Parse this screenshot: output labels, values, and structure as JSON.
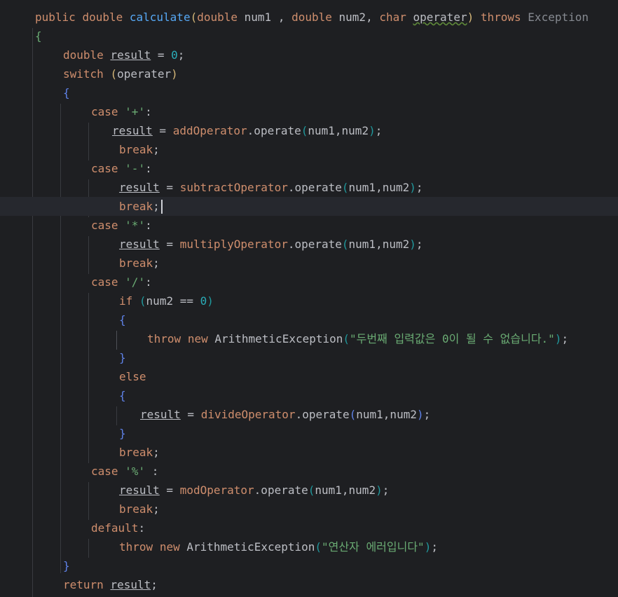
{
  "editor": {
    "signature": {
      "public": "public",
      "double": "double",
      "name": "calculate",
      "paren_open": "(",
      "t1": "double",
      "p1": "num1 ,",
      "t2": "double",
      "p2": "num2,",
      "t3": "char",
      "p3": "operater",
      "paren_close": ")",
      "throws": "throws",
      "exception": "Exception"
    },
    "brace_open_1": "{",
    "decl": {
      "type": "double",
      "var": "result",
      "eq": " = ",
      "val": "0",
      "semi": ";"
    },
    "switch": {
      "kw": "switch",
      "open": "(",
      "arg": "operater",
      "close": ")"
    },
    "brace_open_2": "{",
    "case_plus": {
      "kw": "case",
      "lit": "'+'",
      "colon": ":"
    },
    "stmt_add": {
      "var": "result",
      "eq": " = ",
      "obj": "addOperator",
      "call": ".operate",
      "open": "(",
      "args": "num1,num2",
      "close": ")",
      "semi": ";"
    },
    "break_1": {
      "kw": "break",
      "semi": ";"
    },
    "case_minus": {
      "kw": "case",
      "lit": "'-'",
      "colon": ":"
    },
    "stmt_sub": {
      "var": "result",
      "eq": " = ",
      "obj": "subtractOperator",
      "call": ".operate",
      "open": "(",
      "args": "num1,num2",
      "close": ")",
      "semi": ";"
    },
    "break_2": {
      "kw": "break",
      "semi": ";"
    },
    "case_mul": {
      "kw": "case",
      "lit": "'*'",
      "colon": ":"
    },
    "stmt_mul": {
      "var": "result",
      "eq": " = ",
      "obj": "multiplyOperator",
      "call": ".operate",
      "open": "(",
      "args": "num1,num2",
      "close": ")",
      "semi": ";"
    },
    "break_3": {
      "kw": "break",
      "semi": ";"
    },
    "case_div": {
      "kw": "case",
      "lit": "'/'",
      "colon": ":"
    },
    "if_stmt": {
      "kw": "if",
      "open": "(",
      "cond": "num2 == ",
      "zero": "0",
      "close": ")"
    },
    "brace_open_3": "{",
    "throw_div": {
      "throw": "throw",
      "new": "new",
      "cls": "ArithmeticException",
      "open": "(",
      "msg": "\"두번째 입력값은 0이 될 수 없습니다.\"",
      "close": ")",
      "semi": ";"
    },
    "brace_close_3": "}",
    "else_kw": "else",
    "brace_open_4": "{",
    "stmt_div": {
      "var": "result",
      "eq": " = ",
      "obj": "divideOperator",
      "call": ".operate",
      "open": "(",
      "args": "num1,num2",
      "close": ")",
      "semi": ";"
    },
    "brace_close_4": "}",
    "break_4": {
      "kw": "break",
      "semi": ";"
    },
    "case_mod": {
      "kw": "case",
      "lit": "'%'",
      "colon": " :"
    },
    "stmt_mod": {
      "var": "result",
      "eq": " = ",
      "obj": "modOperator",
      "call": ".operate",
      "open": "(",
      "args": "num1,num2",
      "close": ")",
      "semi": ";"
    },
    "break_5": {
      "kw": "break",
      "semi": ";"
    },
    "default": {
      "kw": "default",
      "colon": ":"
    },
    "throw_default": {
      "throw": "throw",
      "new": "new",
      "cls": "ArithmeticException",
      "open": "(",
      "msg": "\"연산자 에러입니다\"",
      "close": ")",
      "semi": ";"
    },
    "brace_close_2": "}",
    "return": {
      "kw": "return",
      "var": "result",
      "semi": ";"
    }
  },
  "colors": {
    "background": "#1e1f22",
    "keyword": "#cf8e6d",
    "method": "#56a8f5",
    "string": "#6aab73",
    "number": "#2aacb8",
    "text": "#bcbec4",
    "current_line": "#26282e"
  }
}
